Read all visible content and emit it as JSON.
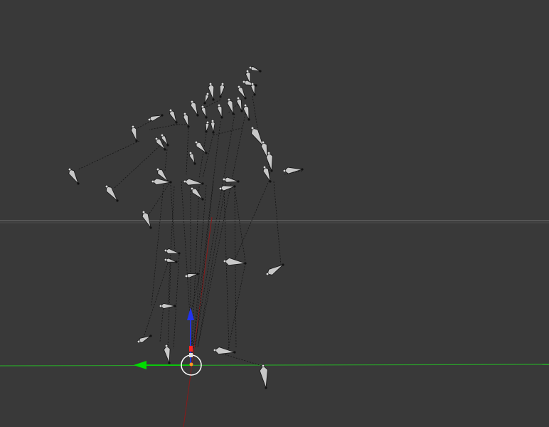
{
  "viewport": {
    "background": "#393939",
    "grid_color": "#4d4d4d",
    "x_axis_color": "#2aa02a",
    "y_axis_color": "#8a1a1a"
  },
  "gizmo": {
    "x_arrow_color": "#00dd00",
    "z_arrow_color": "#2233ee",
    "center_color": "#ffffff",
    "origin_color": "#ff2222",
    "icon": "translate-gizmo-icon"
  },
  "armature": {
    "bone_color": "#c8c8c8",
    "outline_color": "#151515",
    "relationship_line_color": "#141414",
    "icon": "bone-icon"
  }
}
